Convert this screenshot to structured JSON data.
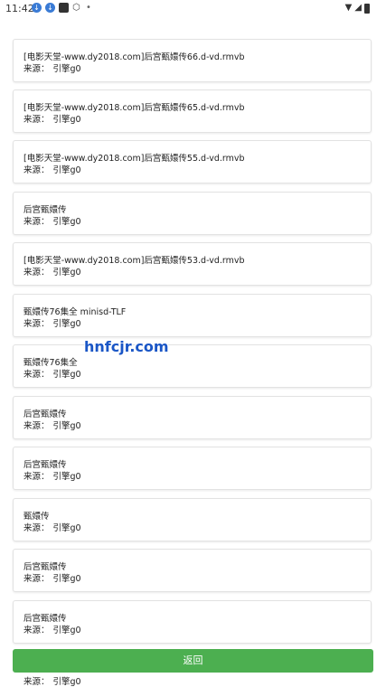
{
  "status_bar": {
    "time": "11:42",
    "left_icons": [
      "notification-blue-icon",
      "notification-blue-icon",
      "app-square-icon",
      "cube-icon",
      "dot-icon"
    ],
    "right_icons": [
      "wifi-icon",
      "signal-icon",
      "battery-icon"
    ]
  },
  "source_label": "来源：",
  "results": [
    {
      "title": "[电影天堂-www.dy2018.com]后宫甄嬛传66.d-vd.rmvb",
      "source": "引擎g0"
    },
    {
      "title": "[电影天堂-www.dy2018.com]后宫甄嬛传65.d-vd.rmvb",
      "source": "引擎g0"
    },
    {
      "title": "[电影天堂-www.dy2018.com]后宫甄嬛传55.d-vd.rmvb",
      "source": "引擎g0"
    },
    {
      "title": "后宫甄嬛传",
      "source": "引擎g0"
    },
    {
      "title": "[电影天堂-www.dy2018.com]后宫甄嬛传53.d-vd.rmvb",
      "source": "引擎g0"
    },
    {
      "title": "甄嬛传76集全 minisd-TLF",
      "source": "引擎g0"
    },
    {
      "title": "甄嬛传76集全",
      "source": "引擎g0"
    },
    {
      "title": "后宫甄嬛传",
      "source": "引擎g0"
    },
    {
      "title": "后宫甄嬛传",
      "source": "引擎g0"
    },
    {
      "title": "甄嬛传",
      "source": "引擎g0"
    },
    {
      "title": "后宫甄嬛传",
      "source": "引擎g0"
    },
    {
      "title": "后宫甄嬛传",
      "source": "引擎g0"
    }
  ],
  "trailing_source": "引擎g0",
  "watermark": "hnfcjr.com",
  "back_button_label": "返回",
  "colors": {
    "accent_green": "#4caf50",
    "watermark_blue": "#1a56c6"
  }
}
